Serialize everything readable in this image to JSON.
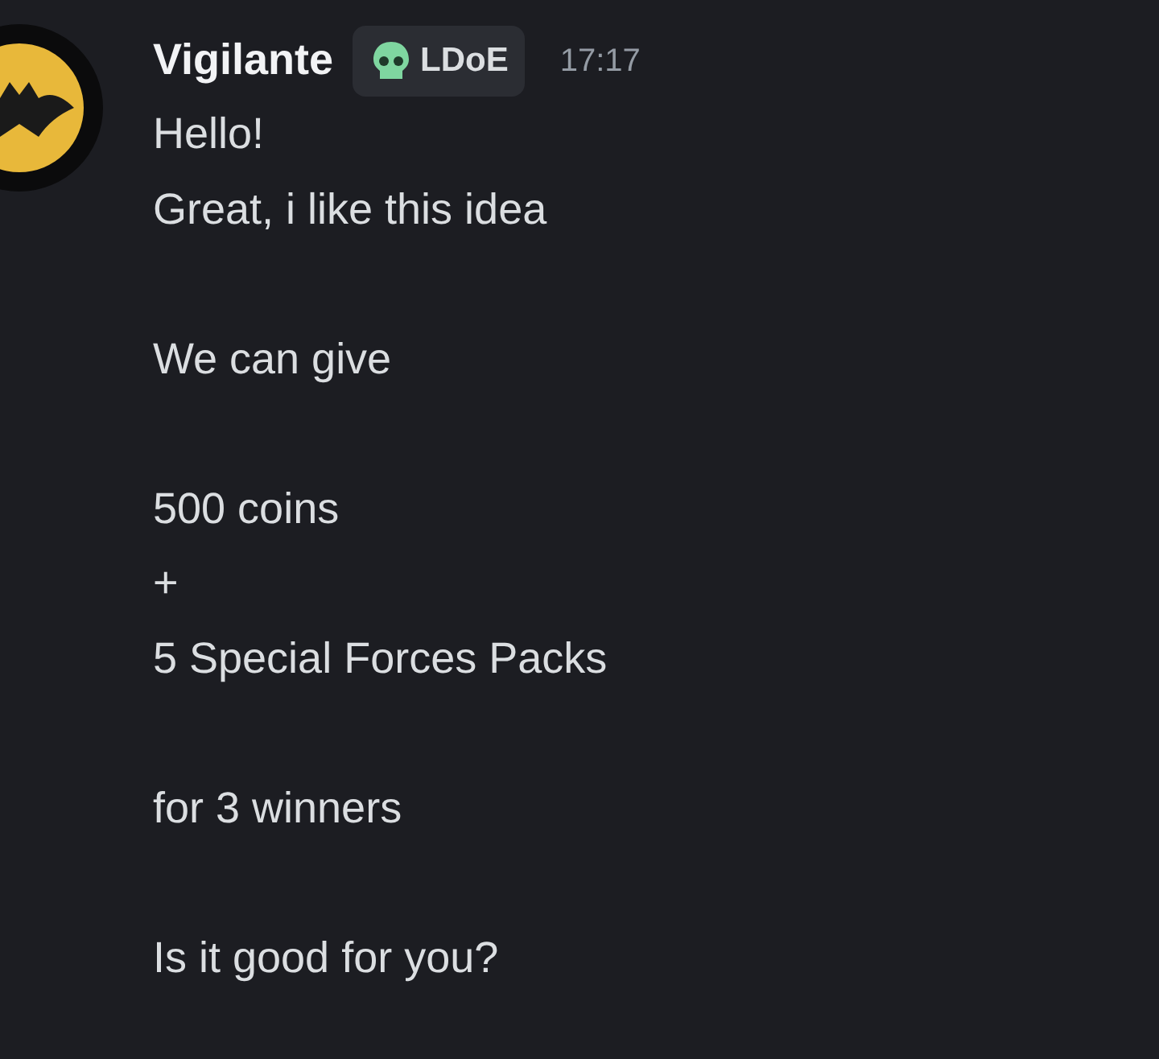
{
  "message": {
    "author": "Vigilante",
    "tag": "LDoE",
    "time": "17:17",
    "blocks": [
      [
        "Hello!",
        "Great, i like this idea"
      ],
      [
        "We can give"
      ],
      [
        "500 coins",
        "+",
        "5 Special Forces Packs"
      ],
      [
        "for 3 winners"
      ],
      [
        "Is it good for you?"
      ]
    ]
  }
}
